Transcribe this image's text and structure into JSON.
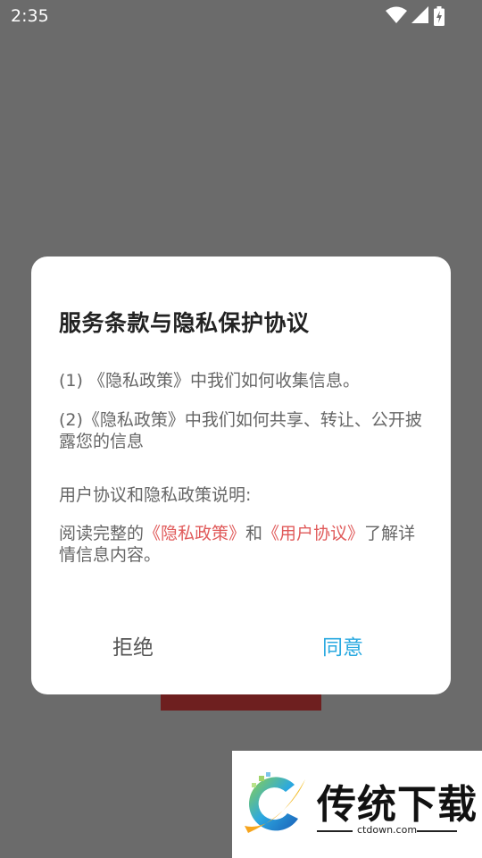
{
  "status_bar": {
    "time": "2:35"
  },
  "dialog": {
    "title": "服务条款与隐私保护协议",
    "item1": "(1) 《隐私政策》中我们如何收集信息。",
    "item2": "(2)《隐私政策》中我们如何共享、转让、公开披露您的信息",
    "section_label": "用户协议和隐私政策说明:",
    "read_prefix": "阅读完整的",
    "privacy_link": "《隐私政策》",
    "and_text": "和",
    "user_agreement_link": "《用户协议》",
    "read_suffix": "了解详情信息内容。",
    "reject_label": "拒绝",
    "agree_label": "同意"
  },
  "watermark": {
    "title": "传统下载",
    "url": "ctdown.com"
  },
  "colors": {
    "overlay": "#6b6b6b",
    "link": "#e05a5a",
    "agree": "#29a9e0",
    "background_block": "#6e1f1f"
  }
}
